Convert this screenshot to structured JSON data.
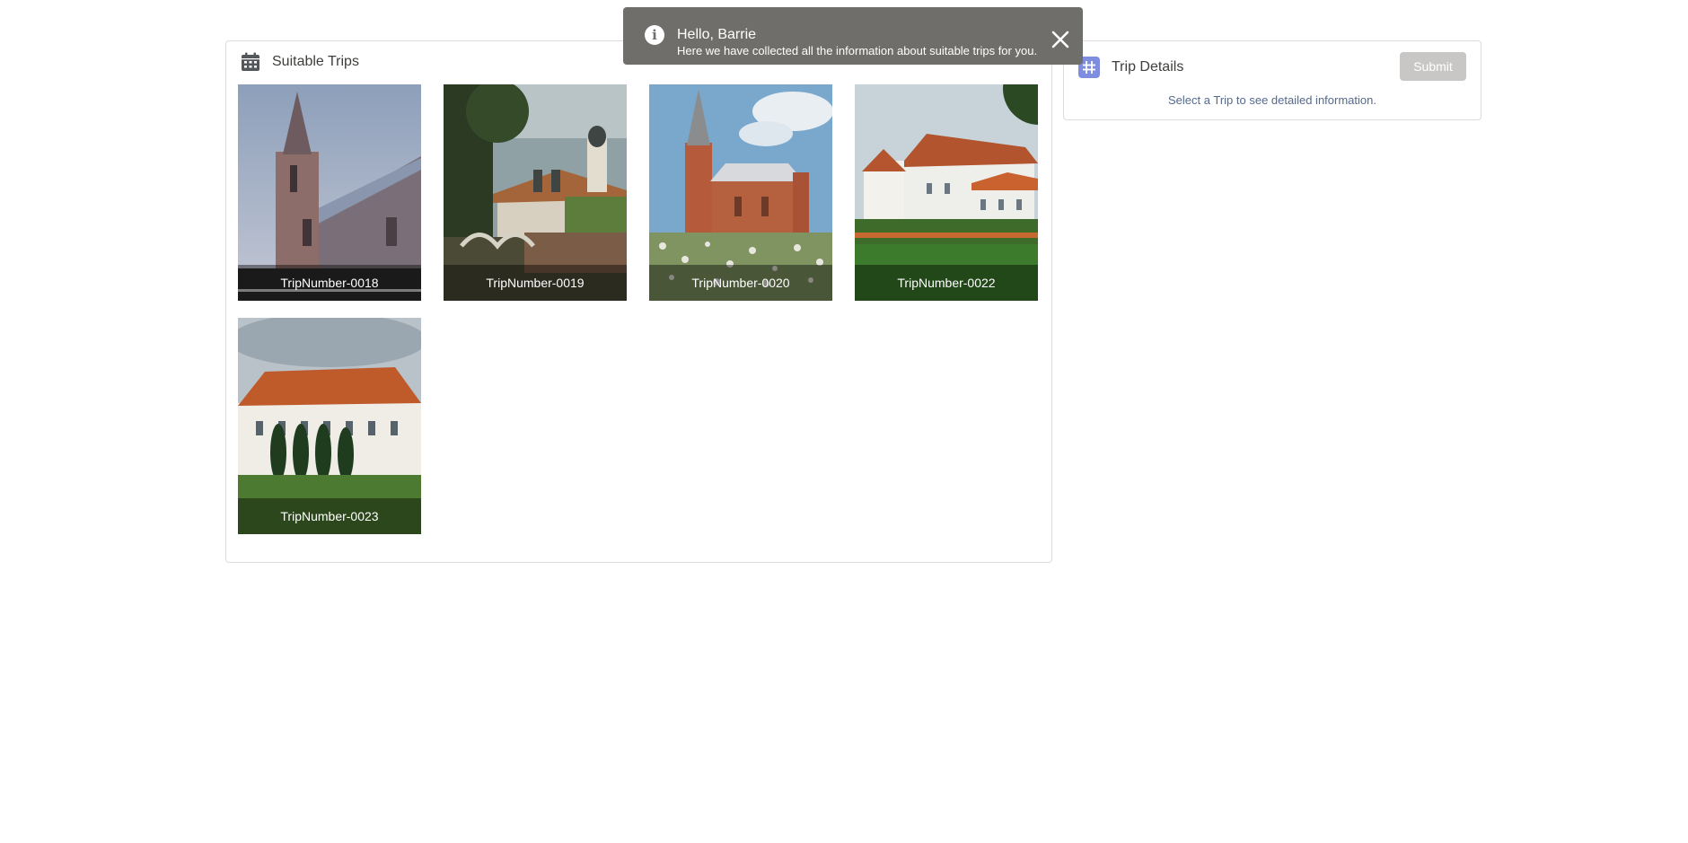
{
  "toast": {
    "icon": "info-icon",
    "title": "Hello, Barrie",
    "message": "Here we have collected all the information about suitable trips for you.",
    "close_icon": "close-icon"
  },
  "trips": {
    "title": "Suitable Trips",
    "icon": "calendar-icon",
    "items": [
      {
        "label": "TripNumber-0018"
      },
      {
        "label": "TripNumber-0019"
      },
      {
        "label": "TripNumber-0020"
      },
      {
        "label": "TripNumber-0022"
      },
      {
        "label": "TripNumber-0023"
      }
    ]
  },
  "details": {
    "title": "Trip Details",
    "icon": "hash-icon",
    "submit_label": "Submit",
    "hint": "Select a Trip to see detailed information."
  },
  "colors": {
    "toast_bg": "#706e6b",
    "border": "#dddbda",
    "hash_icon_bg": "#7f8de1",
    "submit_disabled_bg": "#c9c7c5"
  }
}
